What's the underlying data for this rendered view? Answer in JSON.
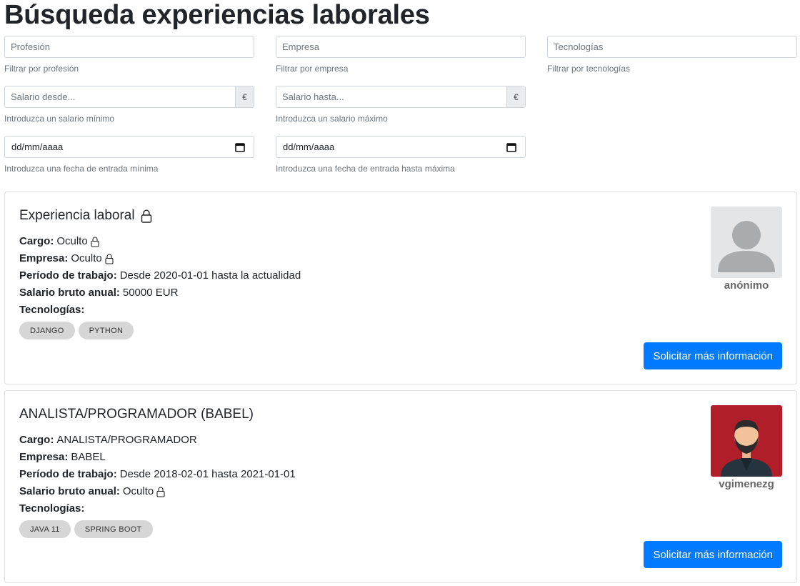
{
  "page": {
    "title": "Búsqueda experiencias laborales"
  },
  "filters": {
    "profession": {
      "placeholder": "Profesión",
      "help": "Filtrar por profesión"
    },
    "company": {
      "placeholder": "Empresa",
      "help": "Filtrar por empresa"
    },
    "technologies": {
      "placeholder": "Tecnologías",
      "help": "Filtrar por tecnologías"
    },
    "salary_from": {
      "placeholder": "Salario desde...",
      "addon": "€",
      "help": "Introduzca un salario mínimo"
    },
    "salary_to": {
      "placeholder": "Salario hasta...",
      "addon": "€",
      "help": "Introduzca un salario máximo"
    },
    "date_from": {
      "value": "dd/mm/aaaa",
      "help": "Introduzca una fecha de entrada mínima"
    },
    "date_to": {
      "value": "dd/mm/aaaa",
      "help": "Introduzca una fecha de entrada hasta máxima"
    }
  },
  "labels": {
    "position": "Cargo:",
    "company": "Empresa:",
    "period": "Período de trabajo:",
    "salary": "Salario bruto anual:",
    "technologies": "Tecnologías:",
    "request_button": "Solicitar más información"
  },
  "experiences": [
    {
      "title": "Experiencia laboral",
      "position": "Oculto",
      "company": "Oculto",
      "period": "Desde 2020-01-01 hasta la actualidad",
      "salary": "50000 EUR",
      "tags": [
        "DJANGO",
        "PYTHON"
      ],
      "user": "anónimo",
      "avatar": "default-avatar-icon"
    },
    {
      "title": "ANALISTA/PROGRAMADOR (BABEL)",
      "position": "ANALISTA/PROGRAMADOR",
      "company": "BABEL",
      "period": "Desde 2018-02-01 hasta 2021-01-01",
      "salary": "Oculto",
      "tags": [
        "JAVA 11",
        "SPRING BOOT"
      ],
      "user": "vgimenezg",
      "avatar": "bearded-man-avatar"
    }
  ],
  "colors": {
    "primary": "#007bff",
    "tag_bg": "#d6d6d6",
    "avatar_red": "#b01e2a",
    "avatar_grey": "#e4e5e6"
  }
}
